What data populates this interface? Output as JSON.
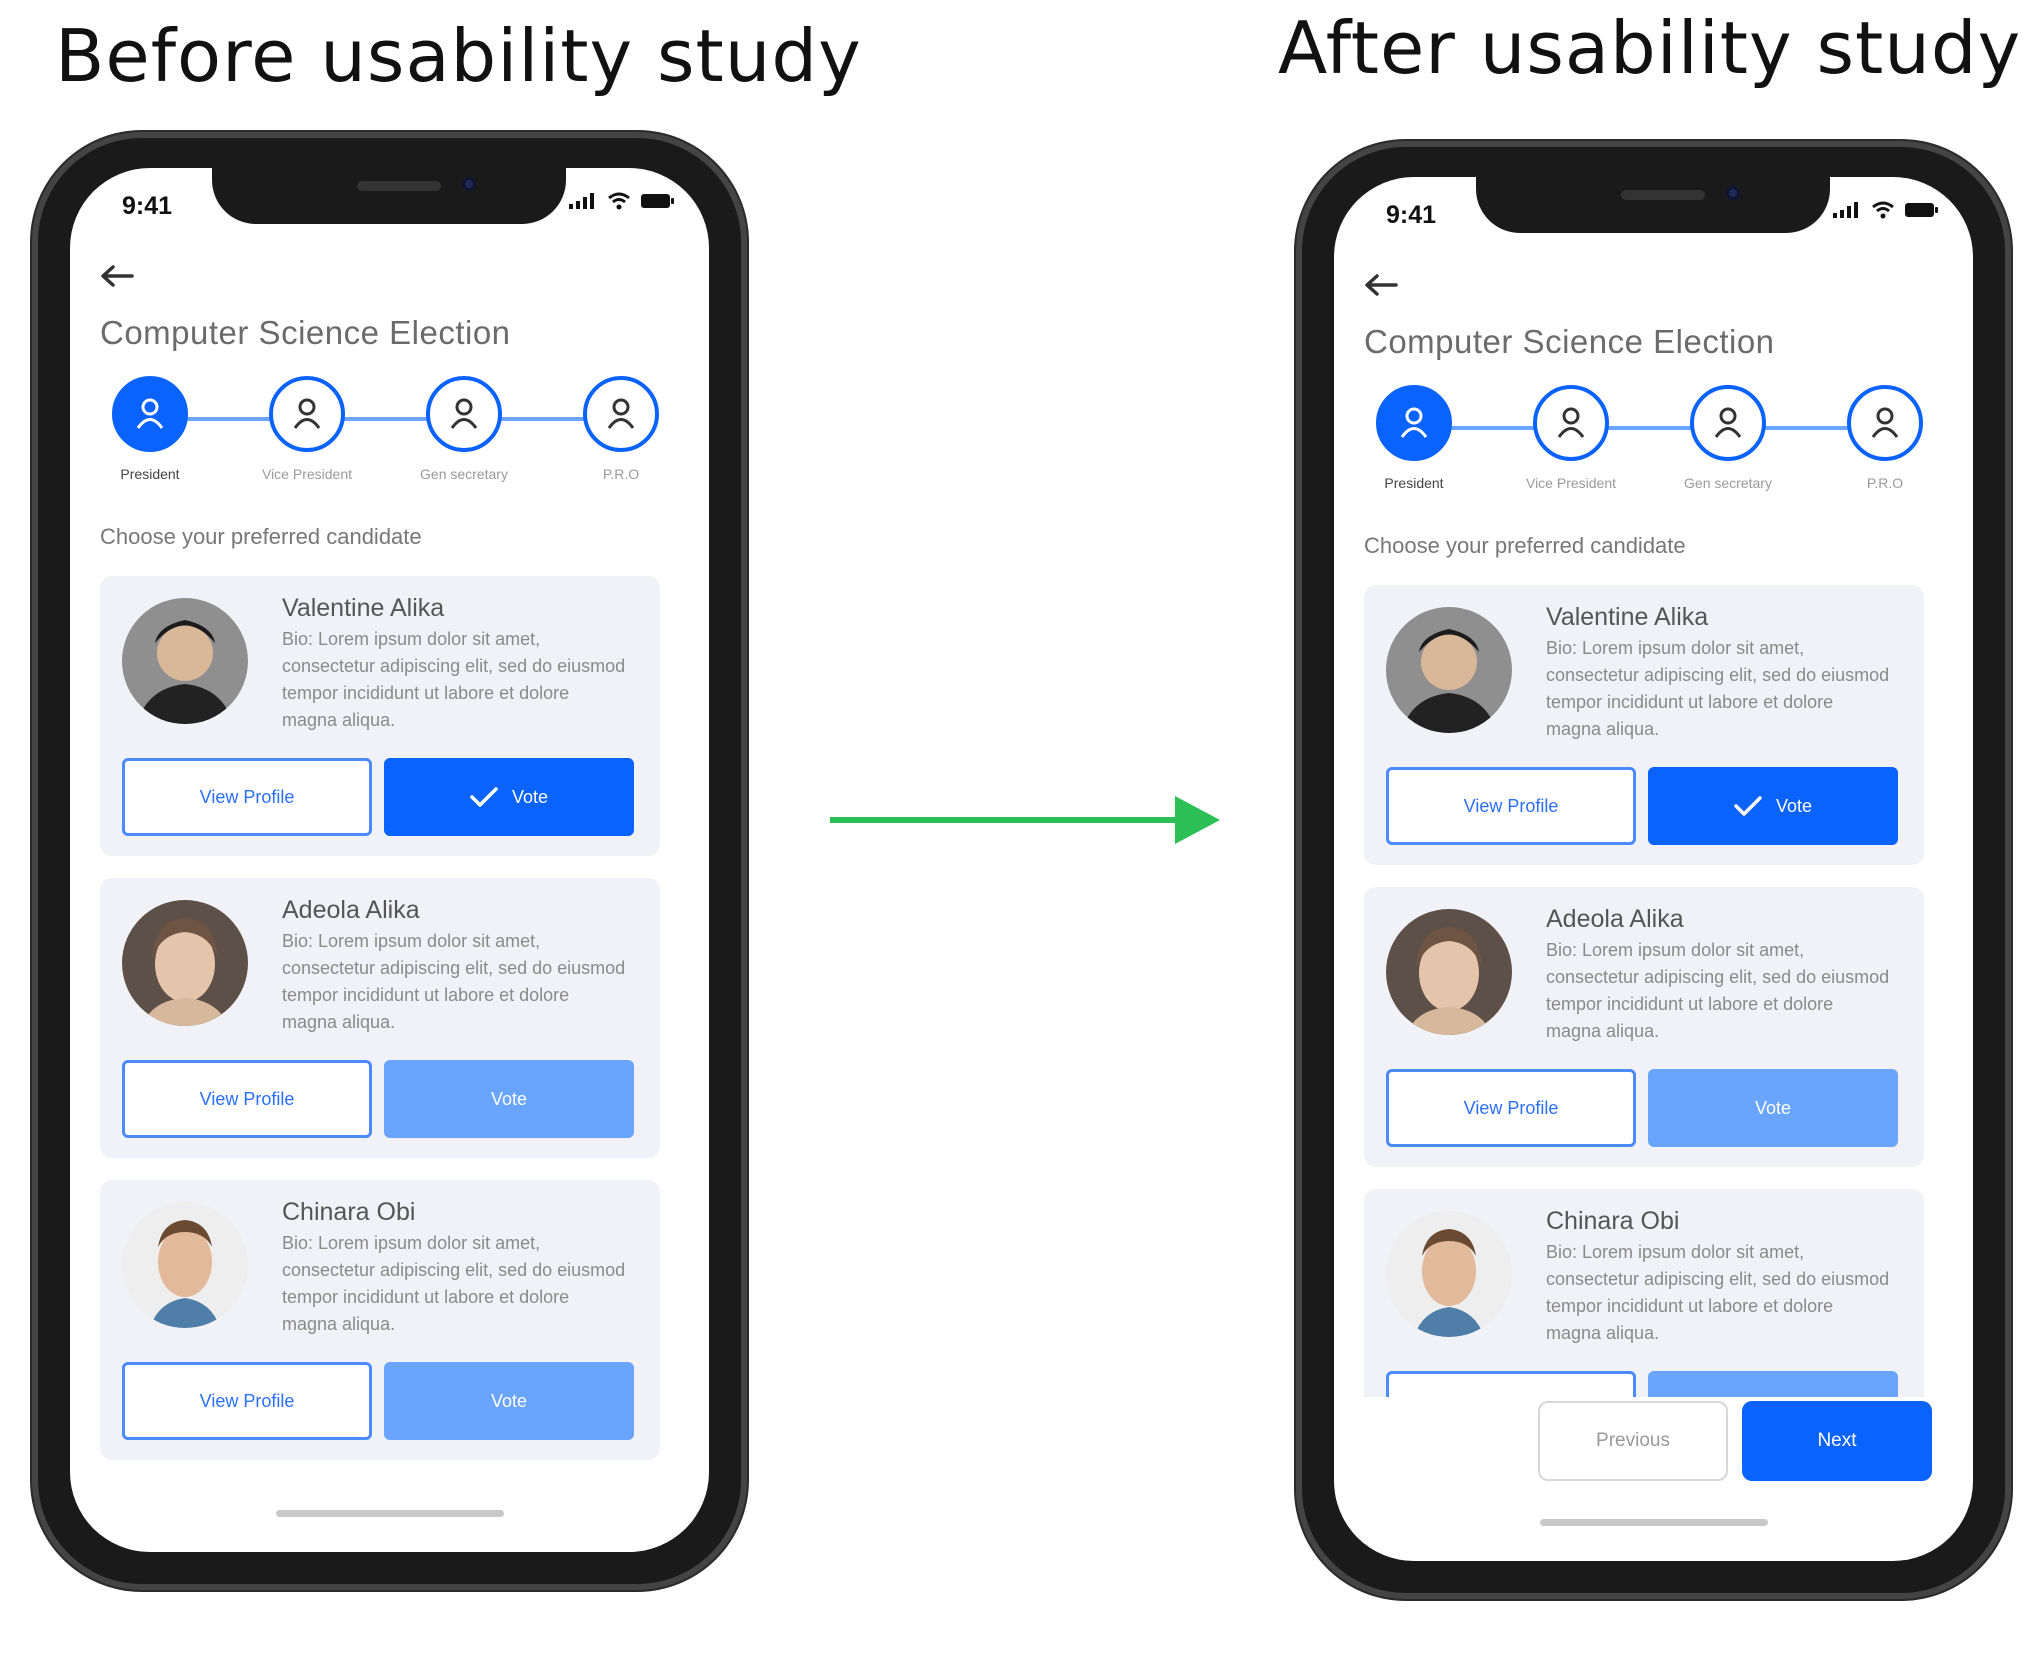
{
  "captions": {
    "before": "Before usability study",
    "after": "After usability study"
  },
  "colors": {
    "primary": "#0a62ff",
    "primary_faded": "#69a5ff",
    "card_bg": "#f1f2f8",
    "arrow": "#2cbf55"
  },
  "icons": {
    "arrow": "right-arrow-icon",
    "back": "back-arrow-icon",
    "person": "person-icon",
    "check": "checkmark-icon"
  },
  "status_bar": {
    "time": "9:41"
  },
  "app": {
    "title": "Computer Science Election",
    "steps": [
      {
        "label": "President",
        "active": true
      },
      {
        "label": "Vice President",
        "active": false
      },
      {
        "label": "Gen secretary",
        "active": false
      },
      {
        "label": "P.R.O",
        "active": false
      }
    ],
    "choose_label": "Choose your preferred candidate",
    "candidates": [
      {
        "name": "Valentine Alika",
        "bio": "Bio: Lorem ipsum dolor sit amet, consectetur adipiscing elit, sed do eiusmod tempor incididunt ut labore et dolore magna aliqua.",
        "view_label": "View Profile",
        "vote_label": "Vote",
        "voted": true
      },
      {
        "name": "Adeola Alika",
        "bio": "Bio: Lorem ipsum dolor sit amet, consectetur adipiscing elit, sed do eiusmod tempor incididunt ut labore et dolore magna aliqua.",
        "view_label": "View Profile",
        "vote_label": "Vote",
        "voted": false
      },
      {
        "name": "Chinara Obi",
        "bio": "Bio: Lorem ipsum dolor sit amet, consectetur adipiscing elit, sed do eiusmod tempor incididunt ut labore et dolore magna aliqua.",
        "view_label": "View Profile",
        "vote_label": "Vote",
        "voted": false
      }
    ],
    "nav": {
      "previous": "Previous",
      "next": "Next"
    }
  }
}
